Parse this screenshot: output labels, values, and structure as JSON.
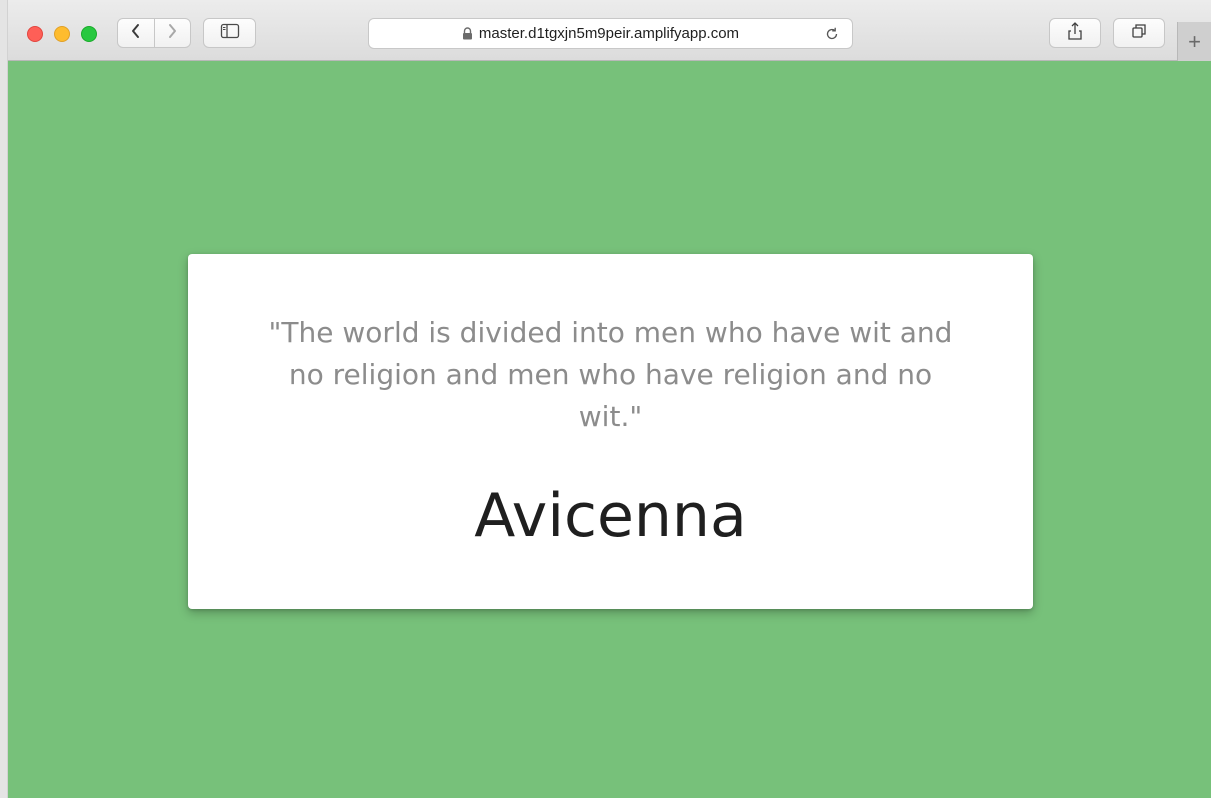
{
  "browser": {
    "address_bar": {
      "url": "master.d1tgxjn5m9peir.amplifyapp.com"
    },
    "new_tab_label": "+",
    "icons": {
      "back": "chevron-left-icon",
      "forward": "chevron-right-icon",
      "sidebar": "sidebar-icon",
      "lock": "lock-icon",
      "reload": "reload-icon",
      "share": "share-icon",
      "tabs": "tab-overview-icon"
    }
  },
  "page": {
    "background_color": "#77c17a",
    "quote": {
      "text": "\"The world is divided into men who have wit and no religion and men who have religion and no wit.\"",
      "author": "Avicenna"
    }
  }
}
